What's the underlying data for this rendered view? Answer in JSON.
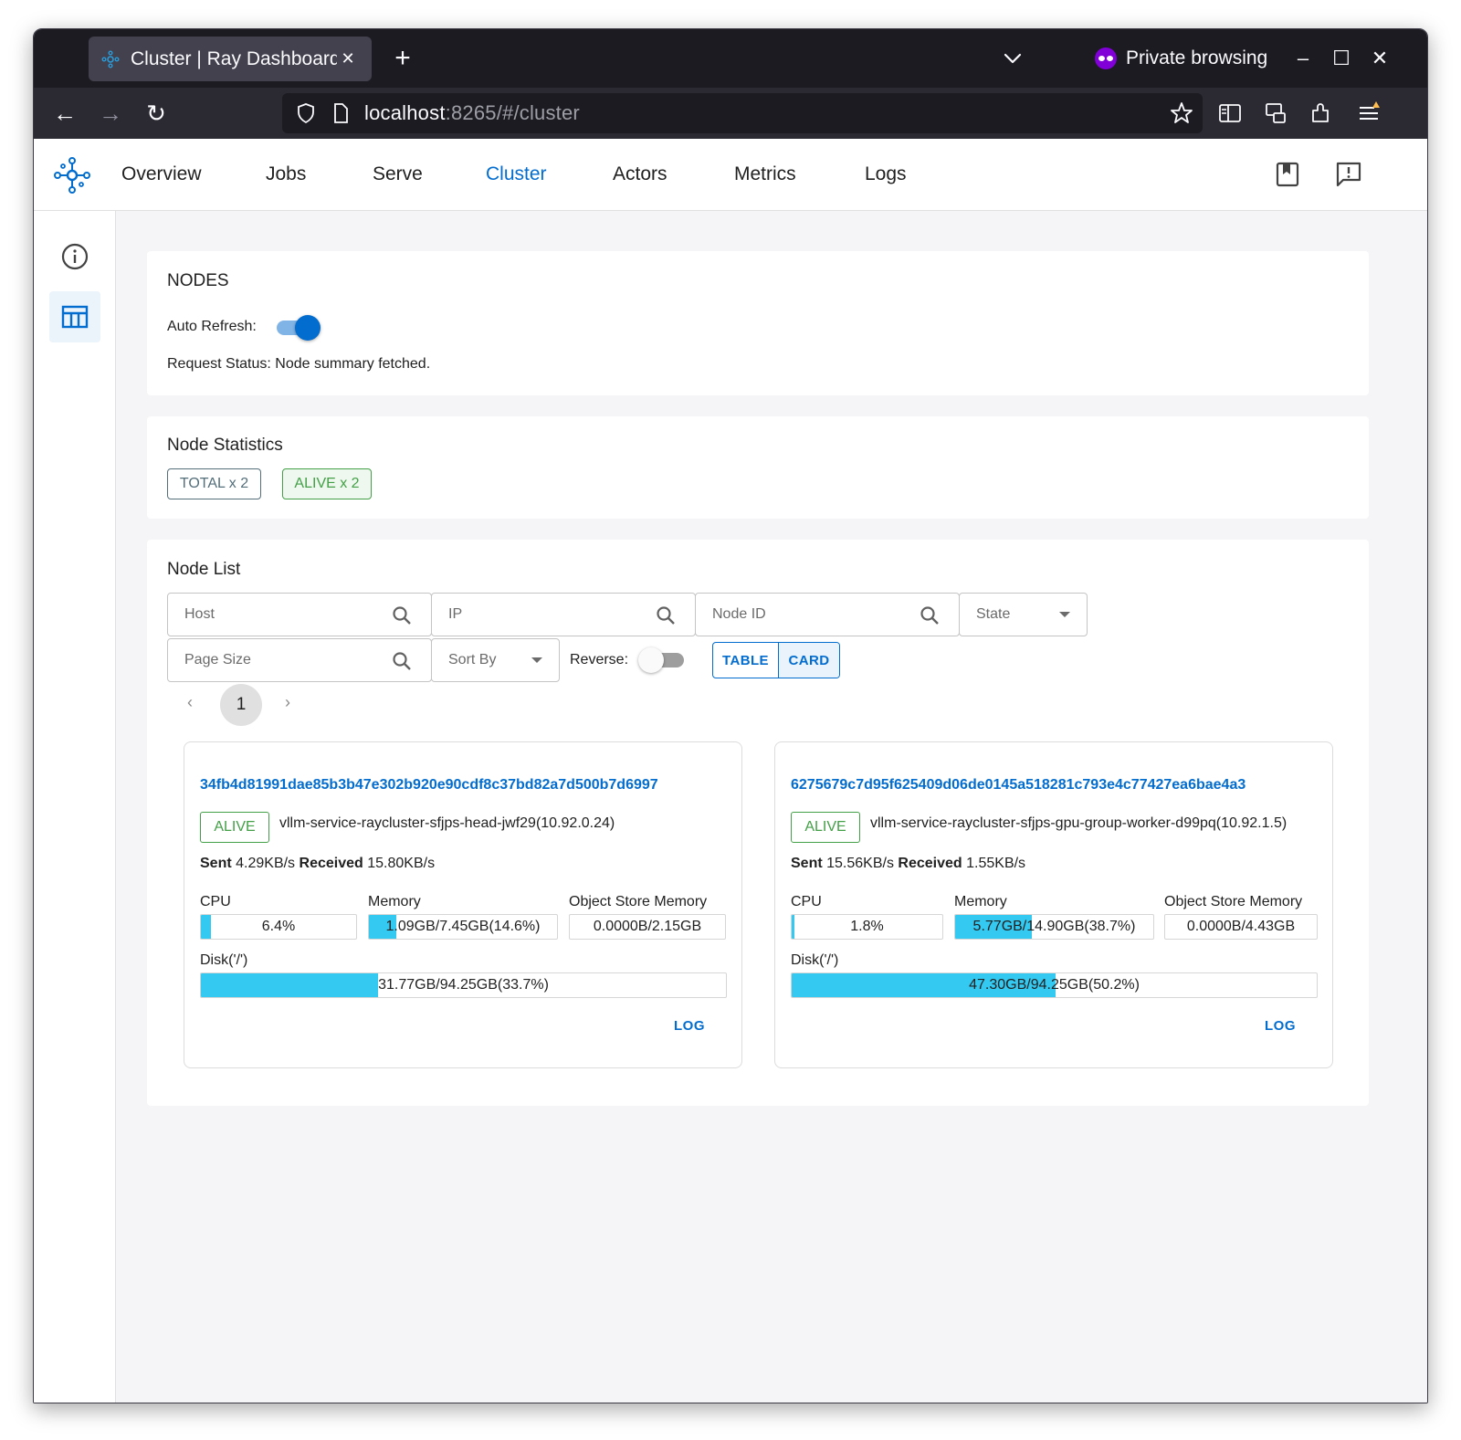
{
  "browser": {
    "tab_title": "Cluster | Ray Dashboard",
    "tab_close": "✕",
    "new_tab": "+",
    "private_label": "Private browsing",
    "url_host": "localhost",
    "url_rest": ":8265/#/cluster",
    "minimize": "–",
    "maximize": "☐",
    "close": "✕",
    "back": "←",
    "forward": "→",
    "reload": "↻"
  },
  "nav": {
    "links": [
      "Overview",
      "Jobs",
      "Serve",
      "Cluster",
      "Actors",
      "Metrics",
      "Logs"
    ],
    "active": "Cluster"
  },
  "nodes_section": {
    "title": "NODES",
    "auto_refresh_label": "Auto Refresh:",
    "auto_refresh_on": true,
    "request_status": "Request Status: Node summary fetched."
  },
  "stats": {
    "title": "Node Statistics",
    "total": "TOTAL x 2",
    "alive": "ALIVE x 2"
  },
  "node_list": {
    "title": "Node List",
    "host_placeholder": "Host",
    "ip_placeholder": "IP",
    "node_id_placeholder": "Node ID",
    "state_label": "State",
    "page_size_placeholder": "Page Size",
    "sort_by_label": "Sort By",
    "reverse_label": "Reverse:",
    "reverse_on": false,
    "view_table": "TABLE",
    "view_card": "CARD",
    "prev": "‹",
    "next": "›",
    "page": "1"
  },
  "nodes": [
    {
      "id": "34fb4d81991dae85b3b47e302b920e90cdf8c37bd82a7d500b7d6997",
      "state": "ALIVE",
      "host": "vllm-service-raycluster-sfjps-head-jwf29(10.92.0.24)",
      "sent_label": "Sent",
      "sent": "4.29KB/s",
      "received_label": "Received",
      "received": "15.80KB/s",
      "cpu_label": "CPU",
      "cpu": "6.4%",
      "cpu_frac": 0.064,
      "memory_label": "Memory",
      "memory": "1.09GB/7.45GB(14.6%)",
      "memory_frac": 0.146,
      "object_store_label": "Object Store Memory",
      "object_store": "0.0000B/2.15GB",
      "object_store_frac": 0.0,
      "disk_label": "Disk('/')",
      "disk": "31.77GB/94.25GB(33.7%)",
      "disk_frac": 0.337,
      "log": "LOG"
    },
    {
      "id": "6275679c7d95f625409d06de0145a518281c793e4c77427ea6bae4a3",
      "state": "ALIVE",
      "host": "vllm-service-raycluster-sfjps-gpu-group-worker-d99pq(10.92.1.5)",
      "sent_label": "Sent",
      "sent": "15.56KB/s",
      "received_label": "Received",
      "received": "1.55KB/s",
      "cpu_label": "CPU",
      "cpu": "1.8%",
      "cpu_frac": 0.018,
      "memory_label": "Memory",
      "memory": "5.77GB/14.90GB(38.7%)",
      "memory_frac": 0.387,
      "object_store_label": "Object Store Memory",
      "object_store": "0.0000B/4.43GB",
      "object_store_frac": 0.0,
      "disk_label": "Disk('/')",
      "disk": "47.30GB/94.25GB(50.2%)",
      "disk_frac": 0.502,
      "log": "LOG"
    }
  ],
  "colors": {
    "accent": "#036dcf",
    "alive": "#43a047",
    "bar_fill": "#34c9f0"
  }
}
